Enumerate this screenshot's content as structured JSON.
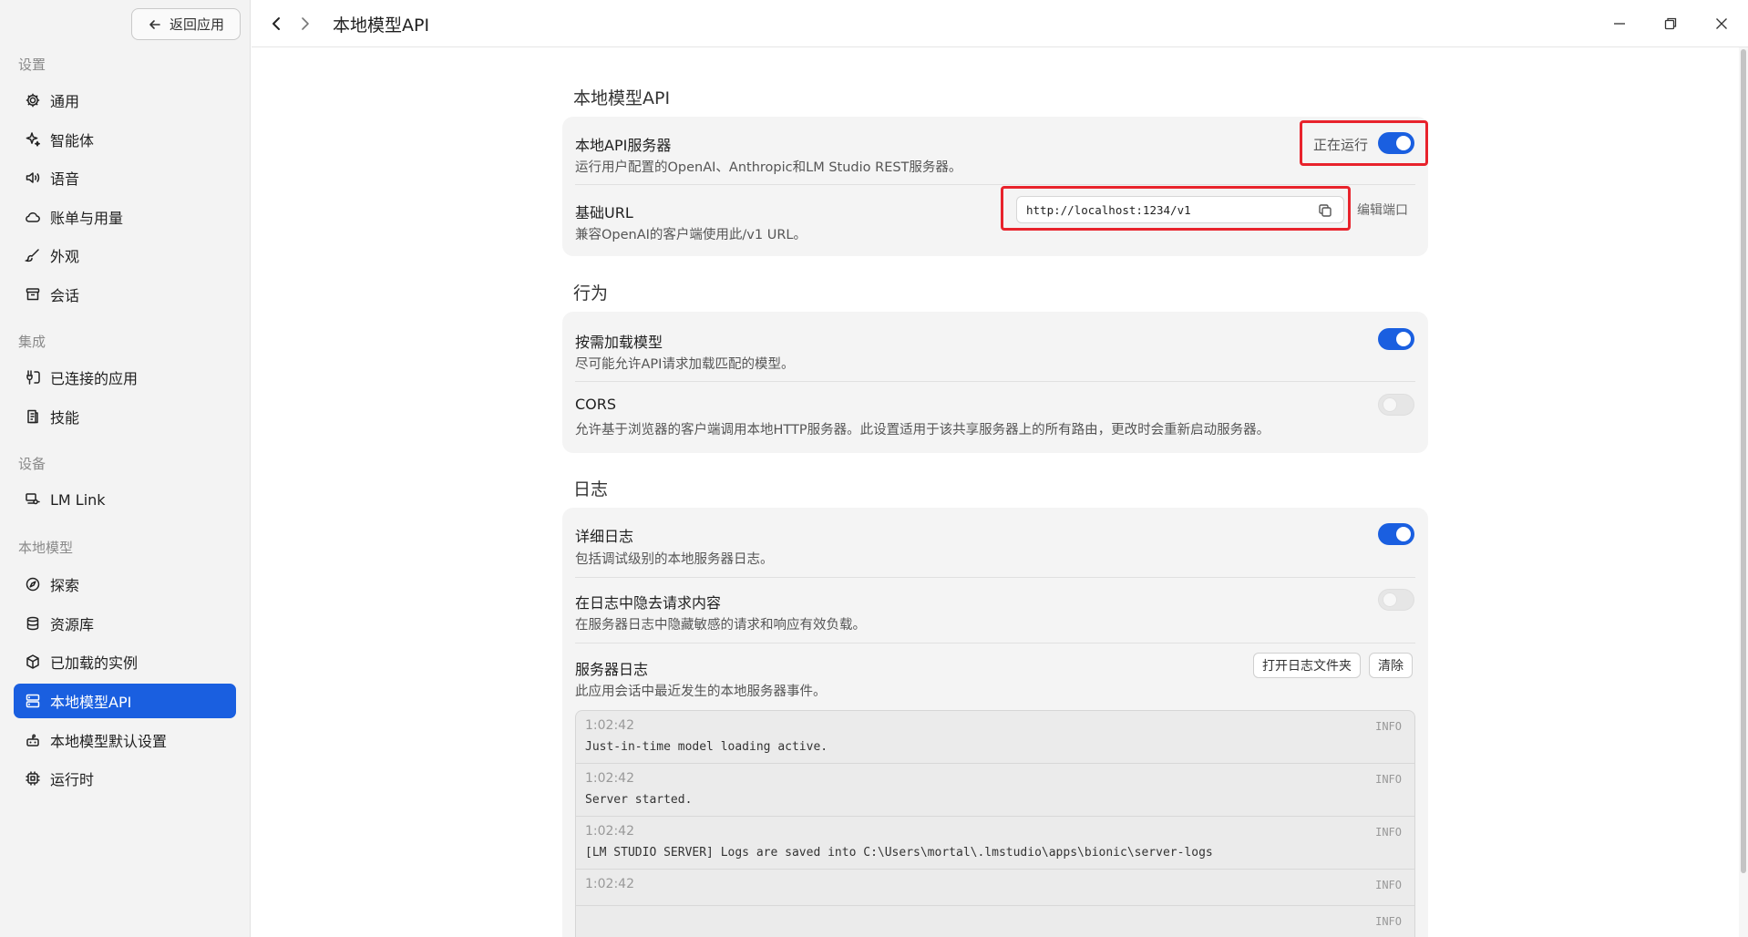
{
  "sidebar": {
    "back_label": "返回应用",
    "sections": {
      "settings": "设置",
      "integrations": "集成",
      "devices": "设备",
      "local_models": "本地模型"
    },
    "items": {
      "general": "通用",
      "agent": "智能体",
      "voice": "语音",
      "billing": "账单与用量",
      "appearance": "外观",
      "sessions": "会话",
      "connected_apps": "已连接的应用",
      "skills": "技能",
      "lm_link": "LM Link",
      "explore": "探索",
      "library": "资源库",
      "loaded_instances": "已加载的实例",
      "local_api": "本地模型API",
      "local_defaults": "本地模型默认设置",
      "runtime": "运行时"
    }
  },
  "header": {
    "title": "本地模型API"
  },
  "main": {
    "server_section": {
      "heading": "本地模型API",
      "server_title": "本地API服务器",
      "server_desc": "运行用户配置的OpenAI、Anthropic和LM Studio REST服务器。",
      "status": "正在运行",
      "server_enabled": true,
      "url_title": "基础URL",
      "url_desc": "兼容OpenAI的客户端使用此/v1 URL。",
      "url_value": "http://localhost:1234/v1",
      "edit_port": "编辑端口"
    },
    "behavior_section": {
      "heading": "行为",
      "jit_title": "按需加载模型",
      "jit_desc": "尽可能允许API请求加载匹配的模型。",
      "jit_enabled": true,
      "cors_title": "CORS",
      "cors_desc": "允许基于浏览器的客户端调用本地HTTP服务器。此设置适用于该共享服务器上的所有路由，更改时会重新启动服务器。",
      "cors_enabled": false
    },
    "logs_section": {
      "heading": "日志",
      "verbose_title": "详细日志",
      "verbose_desc": "包括调试级别的本地服务器日志。",
      "verbose_enabled": true,
      "redact_title": "在日志中隐去请求内容",
      "redact_desc": "在服务器日志中隐藏敏感的请求和响应有效负载。",
      "redact_enabled": false,
      "server_logs_title": "服务器日志",
      "server_logs_desc": "此应用会话中最近发生的本地服务器事件。",
      "open_folder": "打开日志文件夹",
      "clear": "清除",
      "entries": [
        {
          "time": "1:02:42",
          "level": "INFO",
          "message": "Just-in-time model loading active."
        },
        {
          "time": "1:02:42",
          "level": "INFO",
          "message": "Server started."
        },
        {
          "time": "1:02:42",
          "level": "INFO",
          "message": "[LM STUDIO SERVER] Logs are saved into C:\\Users\\mortal\\.lmstudio\\apps\\bionic\\server-logs"
        },
        {
          "time": "1:02:42",
          "level": "INFO",
          "message": ""
        },
        {
          "time": "",
          "level": "INFO",
          "message": ""
        }
      ]
    }
  },
  "colors": {
    "accent": "#1a5fe0",
    "highlight": "#e8232c"
  }
}
